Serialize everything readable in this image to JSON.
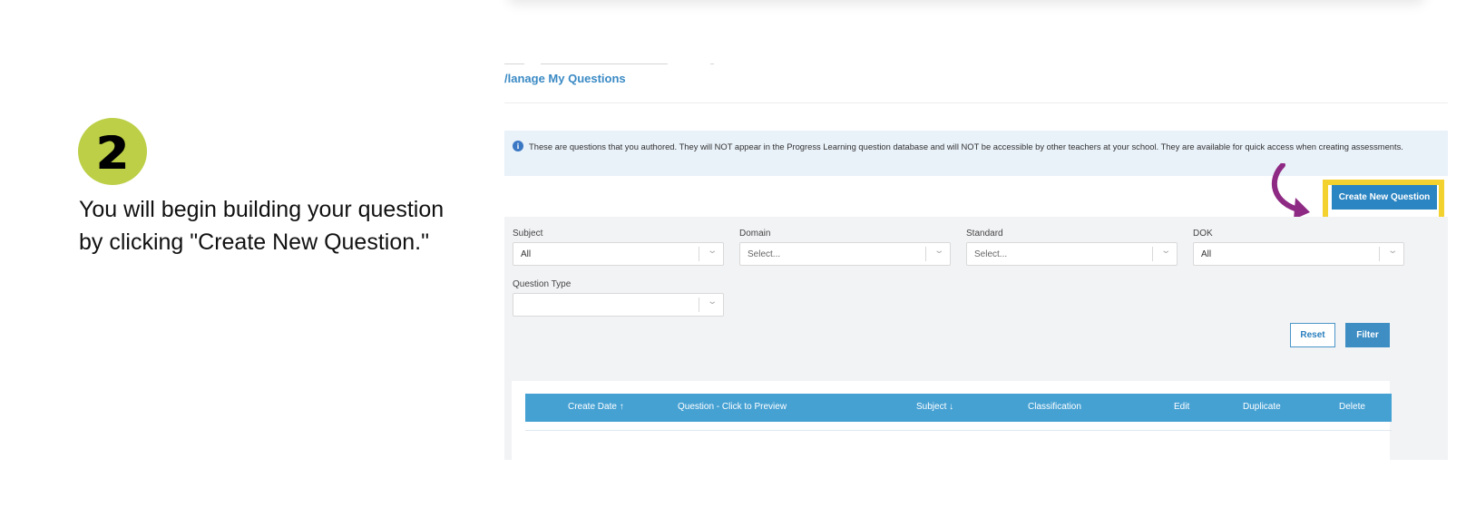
{
  "tutorial": {
    "step_number": "2",
    "instruction": "You will begin building your question by clicking \"Create New Question.\""
  },
  "page": {
    "title": "/lanage My Questions",
    "info_text": "These are questions that you authored. They will NOT appear in the Progress Learning question database and will NOT be accessible by other teachers at your school. They are available for quick access when creating assessments."
  },
  "actions": {
    "create_new_question": "Create New Question",
    "reset": "Reset",
    "filter": "Filter"
  },
  "filters": {
    "subject": {
      "label": "Subject",
      "value": "All"
    },
    "domain": {
      "label": "Domain",
      "placeholder": "Select..."
    },
    "standard": {
      "label": "Standard",
      "placeholder": "Select..."
    },
    "dok": {
      "label": "DOK",
      "value": "All"
    },
    "question_type": {
      "label": "Question Type",
      "value": ""
    }
  },
  "table": {
    "columns": [
      "Create Date ↑",
      "Question - Click to Preview",
      "Subject ↓",
      "Classification",
      "Edit",
      "Duplicate",
      "Delete"
    ]
  },
  "colors": {
    "step_badge": "#bccf46",
    "highlight": "#f3d12f",
    "arrow": "#8e2a84",
    "primary": "#2b85c2",
    "table_header": "#46a1d3"
  }
}
